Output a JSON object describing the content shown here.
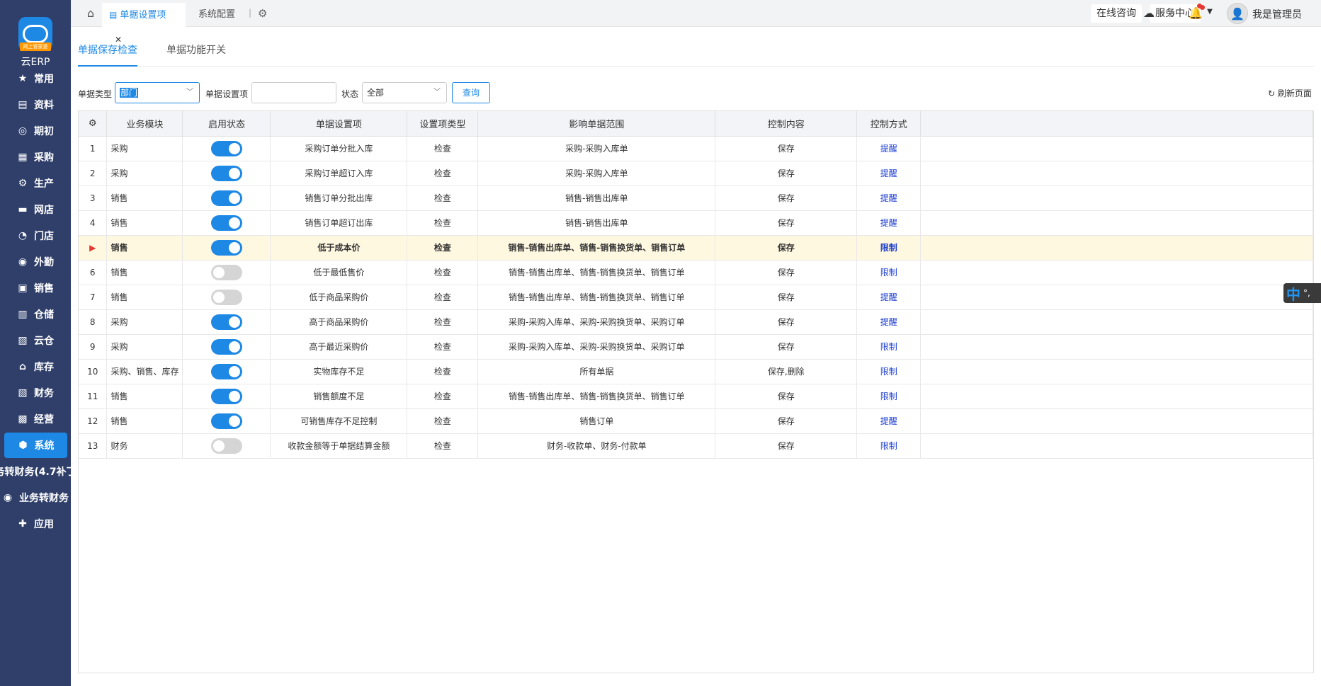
{
  "sidebar": {
    "logo_badge": "网上管家婆",
    "logo_text": "云ERP",
    "items": [
      {
        "label": "常用",
        "icon": "star-icon"
      },
      {
        "label": "资料",
        "icon": "document-icon"
      },
      {
        "label": "期初",
        "icon": "target-icon"
      },
      {
        "label": "采购",
        "icon": "purchase-icon"
      },
      {
        "label": "生产",
        "icon": "production-icon"
      },
      {
        "label": "网店",
        "icon": "store-icon"
      },
      {
        "label": "门店",
        "icon": "pie-icon"
      },
      {
        "label": "外勤",
        "icon": "field-icon"
      },
      {
        "label": "销售",
        "icon": "sales-icon"
      },
      {
        "label": "仓储",
        "icon": "warehouse-icon"
      },
      {
        "label": "云仓",
        "icon": "cloud-warehouse-icon"
      },
      {
        "label": "库存",
        "icon": "inventory-icon"
      },
      {
        "label": "财务",
        "icon": "finance-icon"
      },
      {
        "label": "经营",
        "icon": "chart-icon"
      },
      {
        "label": "系统",
        "icon": "system-icon"
      },
      {
        "label": "务转财务(4.7补丁",
        "icon": ""
      },
      {
        "label": "业务转财务",
        "icon": "convert-icon"
      },
      {
        "label": "应用",
        "icon": "plus-icon"
      }
    ]
  },
  "topbar": {
    "tabs": [
      {
        "label": "单据设置项",
        "active": true
      },
      {
        "label": "系统配置",
        "active": false
      }
    ],
    "online_consult": "在线咨询",
    "service_center": "服务中心",
    "username": "我是管理员"
  },
  "subtabs": [
    "单据保存检查",
    "单据功能开关"
  ],
  "filter": {
    "doc_type_label": "单据类型",
    "doc_type_value": "部门",
    "setting_label": "单据设置项",
    "setting_value": "",
    "status_label": "状态",
    "status_value": "全部",
    "query_label": "查询",
    "refresh_label": "刷新页面"
  },
  "table": {
    "headers": [
      "业务模块",
      "启用状态",
      "单据设置项",
      "设置项类型",
      "影响单据范围",
      "控制内容",
      "控制方式"
    ],
    "rows": [
      {
        "idx": "1",
        "module": "采购",
        "enabled": true,
        "item": "采购订单分批入库",
        "type": "检查",
        "scope": "采购-采购入库单",
        "content": "保存",
        "method": "提醒"
      },
      {
        "idx": "2",
        "module": "采购",
        "enabled": true,
        "item": "采购订单超订入库",
        "type": "检查",
        "scope": "采购-采购入库单",
        "content": "保存",
        "method": "提醒"
      },
      {
        "idx": "3",
        "module": "销售",
        "enabled": true,
        "item": "销售订单分批出库",
        "type": "检查",
        "scope": "销售-销售出库单",
        "content": "保存",
        "method": "提醒"
      },
      {
        "idx": "4",
        "module": "销售",
        "enabled": true,
        "item": "销售订单超订出库",
        "type": "检查",
        "scope": "销售-销售出库单",
        "content": "保存",
        "method": "提醒"
      },
      {
        "idx": "▶",
        "module": "销售",
        "enabled": true,
        "item": "低于成本价",
        "type": "检查",
        "scope": "销售-销售出库单、销售-销售换货单、销售订单",
        "content": "保存",
        "method": "限制",
        "selected": true
      },
      {
        "idx": "6",
        "module": "销售",
        "enabled": false,
        "item": "低于最低售价",
        "type": "检查",
        "scope": "销售-销售出库单、销售-销售换货单、销售订单",
        "content": "保存",
        "method": "限制"
      },
      {
        "idx": "7",
        "module": "销售",
        "enabled": false,
        "item": "低于商品采购价",
        "type": "检查",
        "scope": "销售-销售出库单、销售-销售换货单、销售订单",
        "content": "保存",
        "method": "提醒"
      },
      {
        "idx": "8",
        "module": "采购",
        "enabled": true,
        "item": "高于商品采购价",
        "type": "检查",
        "scope": "采购-采购入库单、采购-采购换货单、采购订单",
        "content": "保存",
        "method": "提醒"
      },
      {
        "idx": "9",
        "module": "采购",
        "enabled": true,
        "item": "高于最近采购价",
        "type": "检查",
        "scope": "采购-采购入库单、采购-采购换货单、采购订单",
        "content": "保存",
        "method": "限制"
      },
      {
        "idx": "10",
        "module": "采购、销售、库存",
        "enabled": true,
        "item": "实物库存不足",
        "type": "检查",
        "scope": "所有单据",
        "content": "保存,删除",
        "method": "限制"
      },
      {
        "idx": "11",
        "module": "销售",
        "enabled": true,
        "item": "销售额度不足",
        "type": "检查",
        "scope": "销售-销售出库单、销售-销售换货单、销售订单",
        "content": "保存",
        "method": "限制"
      },
      {
        "idx": "12",
        "module": "销售",
        "enabled": true,
        "item": "可销售库存不足控制",
        "type": "检查",
        "scope": "销售订单",
        "content": "保存",
        "method": "提醒"
      },
      {
        "idx": "13",
        "module": "财务",
        "enabled": false,
        "item": "收款金额等于单据结算金额",
        "type": "检查",
        "scope": "财务-收款单、财务-付款单",
        "content": "保存",
        "method": "限制"
      }
    ]
  },
  "ime": {
    "zh": "中",
    "punct": "°,"
  }
}
